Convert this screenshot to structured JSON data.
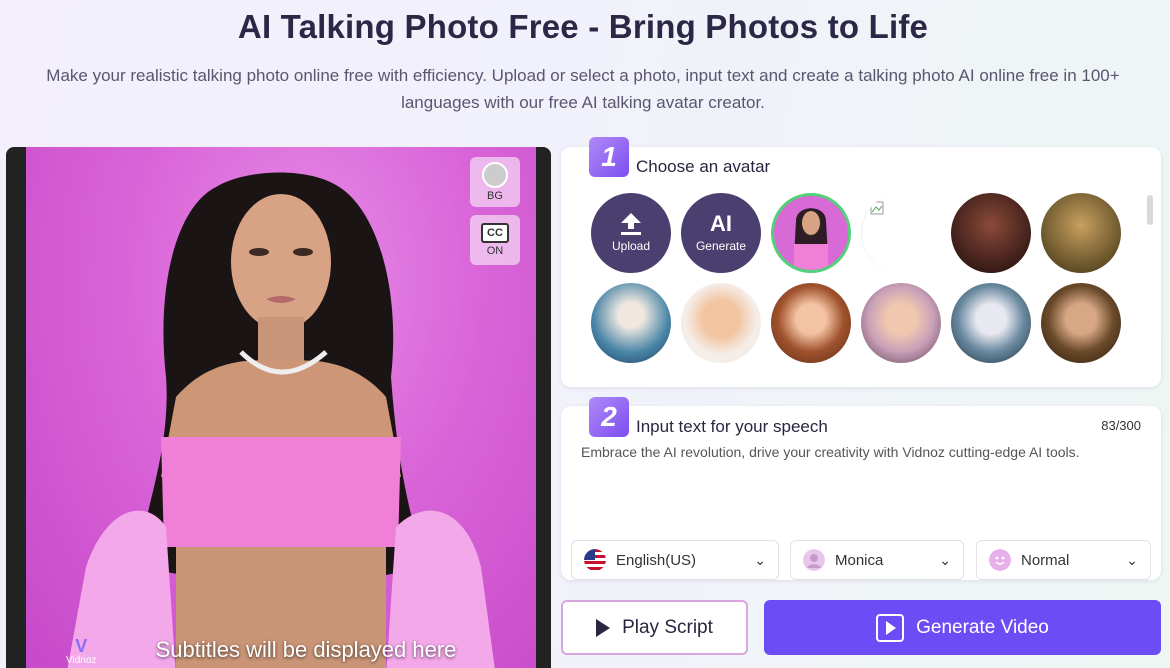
{
  "header": {
    "title": "AI Talking Photo Free - Bring Photos to Life",
    "subtitle": "Make your realistic talking photo online free with efficiency. Upload or select a photo, input text and create a talking photo AI online free in 100+ languages with our free AI talking avatar creator."
  },
  "preview": {
    "bg_label": "BG",
    "cc_icon": "CC",
    "cc_label": "ON",
    "subtitles_text": "Subtitles will be displayed here",
    "watermark": "Vidnoz"
  },
  "step1": {
    "number": "1",
    "heading": "Choose an avatar",
    "upload_label": "Upload",
    "generate_big": "AI",
    "generate_label": "Generate",
    "avatars": [
      {
        "name": "avatar-woman-pink",
        "selected": true,
        "color": "#d86ad6"
      },
      {
        "name": "avatar-broken-image",
        "selected": false,
        "color": "#ffffff"
      },
      {
        "name": "avatar-woman-rose",
        "selected": false,
        "color": "#5a1f1f"
      },
      {
        "name": "avatar-mona-lisa",
        "selected": false,
        "color": "#7a6a30"
      },
      {
        "name": "avatar-einstein",
        "selected": false,
        "color": "#3a6e8a"
      },
      {
        "name": "avatar-cartoon-man",
        "selected": false,
        "color": "#e0a57a"
      },
      {
        "name": "avatar-cartoon-woman",
        "selected": false,
        "color": "#a0522d"
      },
      {
        "name": "avatar-cartoon-blonde",
        "selected": false,
        "color": "#8a5a7a"
      },
      {
        "name": "avatar-robot-woman",
        "selected": false,
        "color": "#5a7a90"
      },
      {
        "name": "avatar-young-man",
        "selected": false,
        "color": "#6a4a2a"
      }
    ]
  },
  "step2": {
    "number": "2",
    "heading": "Input text for your speech",
    "count": "83/300",
    "text": "Embrace the AI revolution, drive your creativity with Vidnoz cutting-edge AI tools.",
    "language": "English(US)",
    "voice": "Monica",
    "style": "Normal"
  },
  "actions": {
    "play_label": "Play Script",
    "generate_label": "Generate Video"
  },
  "colors": {
    "accent": "#6c4cf5",
    "step_badge": "#8b5cf6",
    "preview_bg": "#d964d8"
  }
}
